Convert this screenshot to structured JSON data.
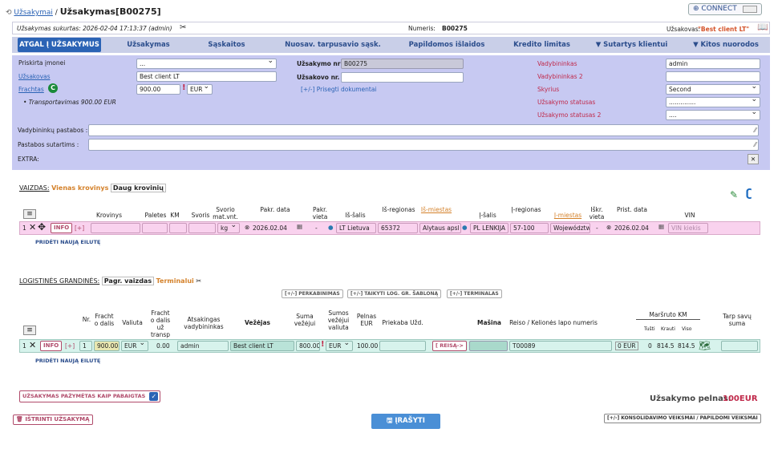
{
  "breadcrumb": {
    "link": "Užsakymai",
    "sep": " / ",
    "title": "Užsakymas[B00275]"
  },
  "connect": {
    "label": "CONNECT"
  },
  "info_bar": {
    "created": "Užsakymas sukurtas: 2026-02-04 17:13:37 (admin)",
    "number_label": "Numeris:",
    "number": "B00275",
    "client_label": "Užsakovas:",
    "client": "\"Best client LT\""
  },
  "tabs": {
    "back": "ATGAL Į UŽSAKYMUS",
    "items": [
      "Užsakymas",
      "Sąskaitos",
      "Nuosav. tarpusavio sąsk.",
      "Papildomos išlaidos",
      "Kredito limitas",
      "▼ Sutartys klientui",
      "▼ Kitos nuorodos"
    ]
  },
  "form": {
    "priskirta_label": "Priskirta įmonei",
    "priskirta_value": "...",
    "uzsakovas_label": "Užsakovas",
    "uzsakovas_value": "Best client LT",
    "frachtas_label": "Frachtas",
    "frachtas_value": "900.00",
    "currency": "EUR",
    "transport_line": "• Transportavimas 900.00 EUR",
    "nr_label": "Užsakymo nr",
    "nr_value": "B00275",
    "uzsakovo_nr_label": "Užsakovo nr. :",
    "uzsakovo_nr_value": "",
    "attach_label": "[+/-] Prisegti dokumentai",
    "vad_label": "Vadybininkas",
    "vad_value": "admin",
    "vad2_label": "Vadybininkas 2",
    "vad2_value": "",
    "skyrius_label": "Skyrius",
    "skyrius_value": "Second",
    "status_label": "Užsakymo statusas",
    "status_value": "..............",
    "status2_label": "Užsakymo statusas 2",
    "status2_value": "....",
    "notes_label": "Vadybininkų pastabos :",
    "contract_label": "Pastabos sutartims :",
    "extra_label": "EXTRA:"
  },
  "cargo": {
    "view_label": "VAIZDAS:",
    "view_one": "Vienas krovinys",
    "view_many": "Daug krovinių",
    "headers": [
      "Krovinys",
      "Paletes",
      "KM",
      "Svoris",
      "Svorio mat.vnt.",
      "Pakr. data",
      "Pakr. vieta",
      "Iš-šalis",
      "Iš-regionas",
      "Iš-miestas",
      "Į-šalis",
      "Į-regionas",
      "Į-miestas",
      "Iškr. vieta",
      "Prist. data",
      "VIN"
    ],
    "row": {
      "num": "1",
      "info": "INFO",
      "plus": "[+]",
      "unit": "kg",
      "load_date": "2026.02.04",
      "load_place": "-",
      "from_country": "LT Lietuva",
      "from_region": "65372",
      "from_city": "Alytaus apsl",
      "to_country": "PL LENKIJA",
      "to_region": "57-100",
      "to_city": "Województw",
      "unload_place": "-",
      "deliv_date": "2026.02.04",
      "vin": "VIN kiekis"
    },
    "add_row": "PRIDĖTI NAUJĄ EILUTĘ"
  },
  "logistics": {
    "title": "LOGISTINĖS GRANDINĖS:",
    "view_a": "Pagr. vaizdas",
    "view_b": "Terminalui",
    "buttons": [
      "[+/-] PERKABINIMAS",
      "[+/-] TAIKYTI LOG. GR. ŠABLONĄ",
      "[+/-] TERMINALAS"
    ],
    "headers": [
      "Nr.",
      "Fracht o dalis",
      "Valiuta",
      "Fracht o dalis už transp",
      "Atsakingas vadybininkas",
      "Vežėjas",
      "Suma vežėjui",
      "Sumos vežėjui valiuta",
      "Pelnas EUR",
      "Priekaba Užd.",
      "Mašina",
      "Reiso / Kelionės lapo numeris",
      "Maršruto KM",
      "Tarp savų suma"
    ],
    "km_sub": [
      "Tušti",
      "Krauti",
      "Viso"
    ],
    "row": {
      "num": "1",
      "info": "INFO",
      "plus": "[+]",
      "one": "1",
      "fracht": "900.00",
      "cur": "EUR",
      "part": "0.00",
      "manager": "admin",
      "carrier": "Best client LT",
      "sum": "800.00",
      "sum_cur": "EUR",
      "profit": "100.00",
      "reis": "[ REISĄ->",
      "trip": "T00089",
      "eur0": "0 EUR",
      "empty": "0",
      "loaded": "814.5",
      "total": "814.5"
    },
    "add_row": "PRIDĖTI NAUJĄ EILUTĘ"
  },
  "footer": {
    "done_label": "UŽSAKYMAS PAŽYMĖTAS KAIP PABAIGTAS",
    "profit_label": "Užsakymo pelnas:",
    "profit_value": "100EUR",
    "delete": "IŠTRINTI UŽSAKYMĄ",
    "save": "ĮRAŠYTI",
    "consolidation": "[+/-] KONSOLIDAVIMO VEIKSMAI / PAPILDOMI VEIKSMAI"
  },
  "colors": {
    "tabbar": "#c9cfe8",
    "form_bg": "#c7c9f2",
    "back_tab": "#2b63b5",
    "save_btn": "#4a8fd6",
    "accent_red": "#c0294a",
    "orange": "#d4812a"
  }
}
